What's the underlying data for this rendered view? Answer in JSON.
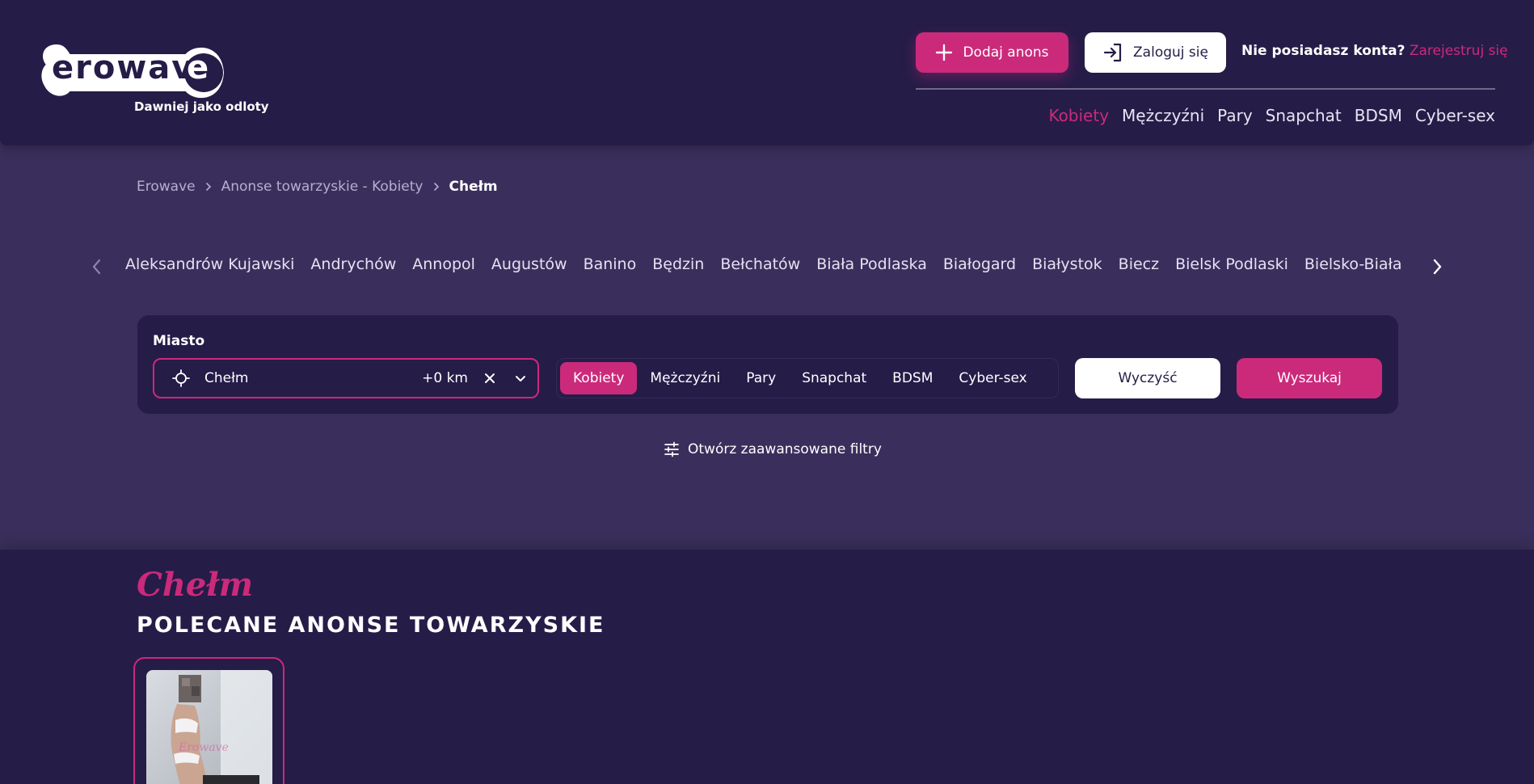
{
  "header": {
    "logo_text": "erowav",
    "logo_e": "e",
    "logo_subtitle": "Dawniej jako odloty",
    "add_button": "Dodaj anons",
    "login_button": "Zaloguj się",
    "register_question": "Nie posiadasz konta?",
    "register_link": "Zarejestruj się",
    "nav": [
      "Kobiety",
      "Mężczyźni",
      "Pary",
      "Snapchat",
      "BDSM",
      "Cyber-sex"
    ]
  },
  "breadcrumb": [
    "Erowave",
    "Anonse towarzyskie - Kobiety",
    "Chełm"
  ],
  "cities": [
    "Aleksandrów Kujawski",
    "Andrychów",
    "Annopol",
    "Augustów",
    "Banino",
    "Będzin",
    "Bełchatów",
    "Biała Podlaska",
    "Białogard",
    "Białystok",
    "Biecz",
    "Bielsk Podlaski",
    "Bielsko-Biała"
  ],
  "search": {
    "label": "Miasto",
    "city_value": "Chełm",
    "distance": "+0 km",
    "categories": [
      "Kobiety",
      "Mężczyźni",
      "Pary",
      "Snapchat",
      "BDSM",
      "Cyber-sex"
    ],
    "active_category": "Kobiety",
    "clear_button": "Wyczyść",
    "search_button": "Wyszukaj",
    "advanced_filters": "Otwórz zaawansowane filtry"
  },
  "section": {
    "city_name": "Chełm",
    "title": "POLECANE ANONSE TOWARZYSKIE"
  },
  "colors": {
    "accent": "#cb2a7b",
    "header_bg": "#261c48",
    "page_bg": "#3a2f5c"
  }
}
